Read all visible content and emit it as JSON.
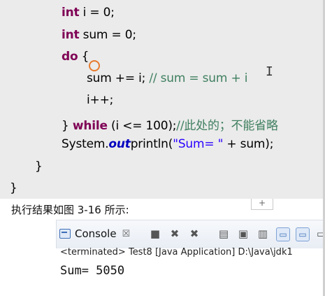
{
  "code": {
    "lines": [
      {
        "kw": "int",
        "text": " i = 0;"
      },
      {
        "kw": "int",
        "text": " sum = 0;"
      },
      {
        "kw": "do",
        "text": " {"
      },
      {
        "text": "sum += i; ",
        "comment": "// sum = sum + i"
      },
      {
        "text": "i++;"
      },
      {
        "pre": "} ",
        "kw": "while",
        "text": " (i <= 100);",
        "comment": "//此处的；不能省略"
      },
      {
        "pre": "System.",
        "field": "out",
        "text": "println(",
        "string": "\"Sum= \"",
        "post": " + sum);"
      },
      {
        "text": "}"
      },
      {
        "text": "}"
      }
    ]
  },
  "caption": "执行结果如图 3-16 所示:",
  "expand_tab": "+",
  "console": {
    "tab_label": "Console",
    "tab_close": "☒",
    "terminated_line": "<terminated> Test8 [Java Application] D:\\Java\\jdk1",
    "output": "Sum= 5050"
  }
}
